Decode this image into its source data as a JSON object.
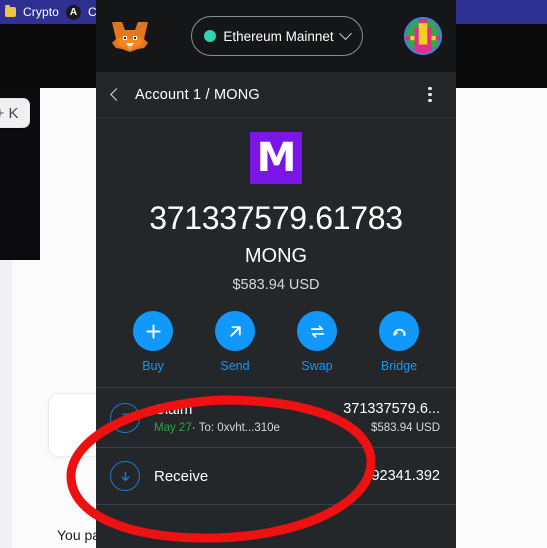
{
  "browser": {
    "bookmarks": [
      {
        "icon": "folder-icon",
        "label": "Crypto"
      },
      {
        "icon": "letter-a-avatar-icon",
        "label": "C"
      }
    ]
  },
  "background_page": {
    "shortcut_chip": "+ K",
    "partial_text": "You pa"
  },
  "metamask": {
    "header": {
      "logo_icon": "metamask-fox-icon",
      "network": {
        "label": "Ethereum Mainnet",
        "dot_color": "#2fd3b6",
        "chevron_icon": "chevron-down-icon"
      },
      "avatar_icon": "account-blockie-icon"
    },
    "account_bar": {
      "back_icon": "chevron-left-icon",
      "title": "Account 1 / MONG",
      "menu_icon": "kebab-menu-icon"
    },
    "token": {
      "logo_letter": "M",
      "logo_color": "#7b16e8",
      "balance": "371337579.61783",
      "symbol": "MONG",
      "fiat": "$583.94 USD"
    },
    "actions": [
      {
        "label": "Buy",
        "icon": "plus-icon"
      },
      {
        "label": "Send",
        "icon": "arrow-up-right-icon"
      },
      {
        "label": "Swap",
        "icon": "swap-arrows-icon"
      },
      {
        "label": "Bridge",
        "icon": "bridge-arc-icon"
      }
    ],
    "accent_color": "#1098fc",
    "transactions": [
      {
        "icon": "arrow-up-right-circle-icon",
        "title": "Claim",
        "date": "May 27",
        "separator": "·",
        "detail": "To: 0xvht...310e",
        "amount": "371337579.6...",
        "fiat": "$583.94 USD"
      },
      {
        "icon": "arrow-down-circle-icon",
        "title": "Receive",
        "date": "",
        "separator": "",
        "detail": "",
        "amount": "492341.392",
        "fiat": ""
      }
    ]
  },
  "annotation": {
    "shape": "red-ellipse-highlight",
    "color": "#ef1111"
  }
}
